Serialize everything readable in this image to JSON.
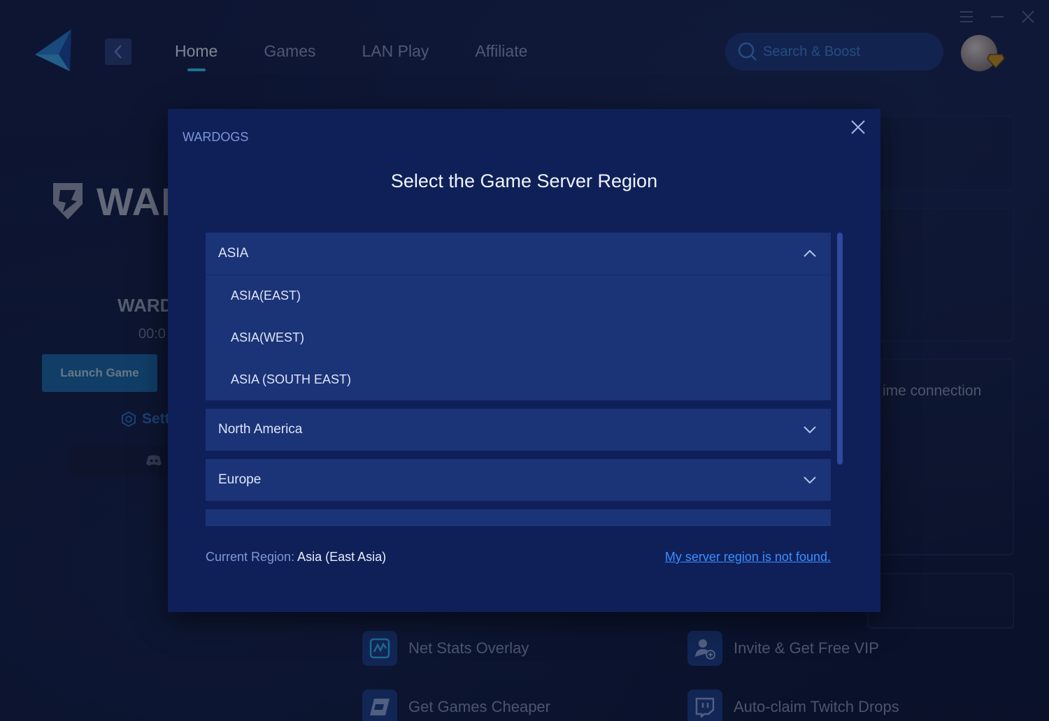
{
  "nav": {
    "items": [
      {
        "label": "Home",
        "active": true
      },
      {
        "label": "Games",
        "active": false
      },
      {
        "label": "LAN Play",
        "active": false
      },
      {
        "label": "Affiliate",
        "active": false
      }
    ],
    "search_placeholder": "Search & Boost"
  },
  "game_panel": {
    "logo_text": "WAR",
    "name": "WARD",
    "timer": "00:0",
    "launch_label": "Launch Game",
    "settings_label": "Sett"
  },
  "right_panel": {
    "realtime_text": "ime connection"
  },
  "features": [
    {
      "label": "Net Stats Overlay",
      "icon": "chart-icon"
    },
    {
      "label": "Invite & Get Free VIP",
      "icon": "user-plus-icon"
    },
    {
      "label": "Get Games Cheaper",
      "icon": "tag-icon"
    },
    {
      "label": "Auto-claim Twitch Drops",
      "icon": "twitch-icon"
    }
  ],
  "modal": {
    "game_label": "WARDOGS",
    "title": "Select the Game Server Region",
    "regions": [
      {
        "name": "ASIA",
        "expanded": true,
        "children": [
          "ASIA(EAST)",
          "ASIA(WEST)",
          "ASIA (SOUTH EAST)"
        ]
      },
      {
        "name": "North America",
        "expanded": false
      },
      {
        "name": "Europe",
        "expanded": false
      },
      {
        "name": "",
        "expanded": false
      }
    ],
    "current_region_label": "Current Region:",
    "current_region_value": "Asia (East Asia)",
    "not_found_link": "My server region is not found."
  },
  "colors": {
    "accent": "#34c6f4",
    "modal_bg": "#0f2059",
    "region_bg": "#1b3377",
    "link": "#3b8fff"
  }
}
